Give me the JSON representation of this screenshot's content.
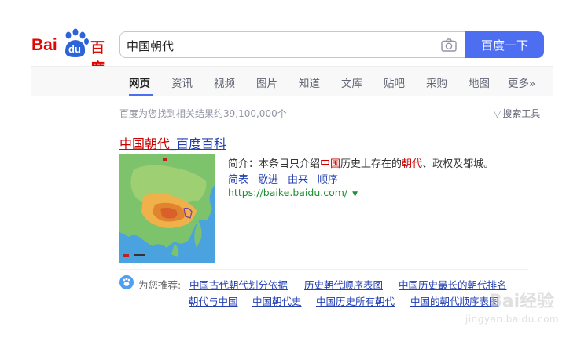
{
  "logo": {
    "text_latin": "Bai",
    "text_du": "du",
    "text_cn": "百度"
  },
  "search": {
    "query": "中国朝代",
    "button_label": "百度一下"
  },
  "tabs": [
    {
      "label": "网页",
      "active": true
    },
    {
      "label": "资讯"
    },
    {
      "label": "视频"
    },
    {
      "label": "图片"
    },
    {
      "label": "知道"
    },
    {
      "label": "文库"
    },
    {
      "label": "贴吧"
    },
    {
      "label": "采购"
    },
    {
      "label": "地图"
    },
    {
      "label": "更多»"
    }
  ],
  "results_meta": {
    "count_text": "百度为您找到相关结果约39,100,000个",
    "tools_label": "搜索工具"
  },
  "result": {
    "title_em": "中国朝代",
    "title_rest": "_百度百科",
    "abstract_prefix": "简介：本条目只介绍",
    "abstract_em1": "中国",
    "abstract_mid": "历史上存在的",
    "abstract_em2": "朝代",
    "abstract_suffix": "、政权及都城。",
    "sublinks": [
      "简表",
      "歇进",
      "由来",
      "顺序"
    ],
    "url": "https://baike.baidu.com/"
  },
  "recommend": {
    "label": "为您推荐:",
    "links_row1": [
      "中国古代朝代划分依据",
      "历史朝代顺序表图",
      "中国历史最长的朝代排名"
    ],
    "links_row2": [
      "朝代与中国",
      "中国朝代史",
      "中国历史所有朝代",
      "中国的朝代顺序表图"
    ]
  },
  "watermark": {
    "cn": "Bai经验",
    "en": "jingyan.baidu.com"
  },
  "colors": {
    "accent": "#4e6ef2",
    "brand_red": "#e10601",
    "link": "#2440b3",
    "highlight": "#c00",
    "url_green": "#1e8f33"
  },
  "icons": {
    "camera": "camera-icon",
    "funnel": "funnel-icon",
    "paw": "paw-icon",
    "caret": "caret-down-icon"
  }
}
